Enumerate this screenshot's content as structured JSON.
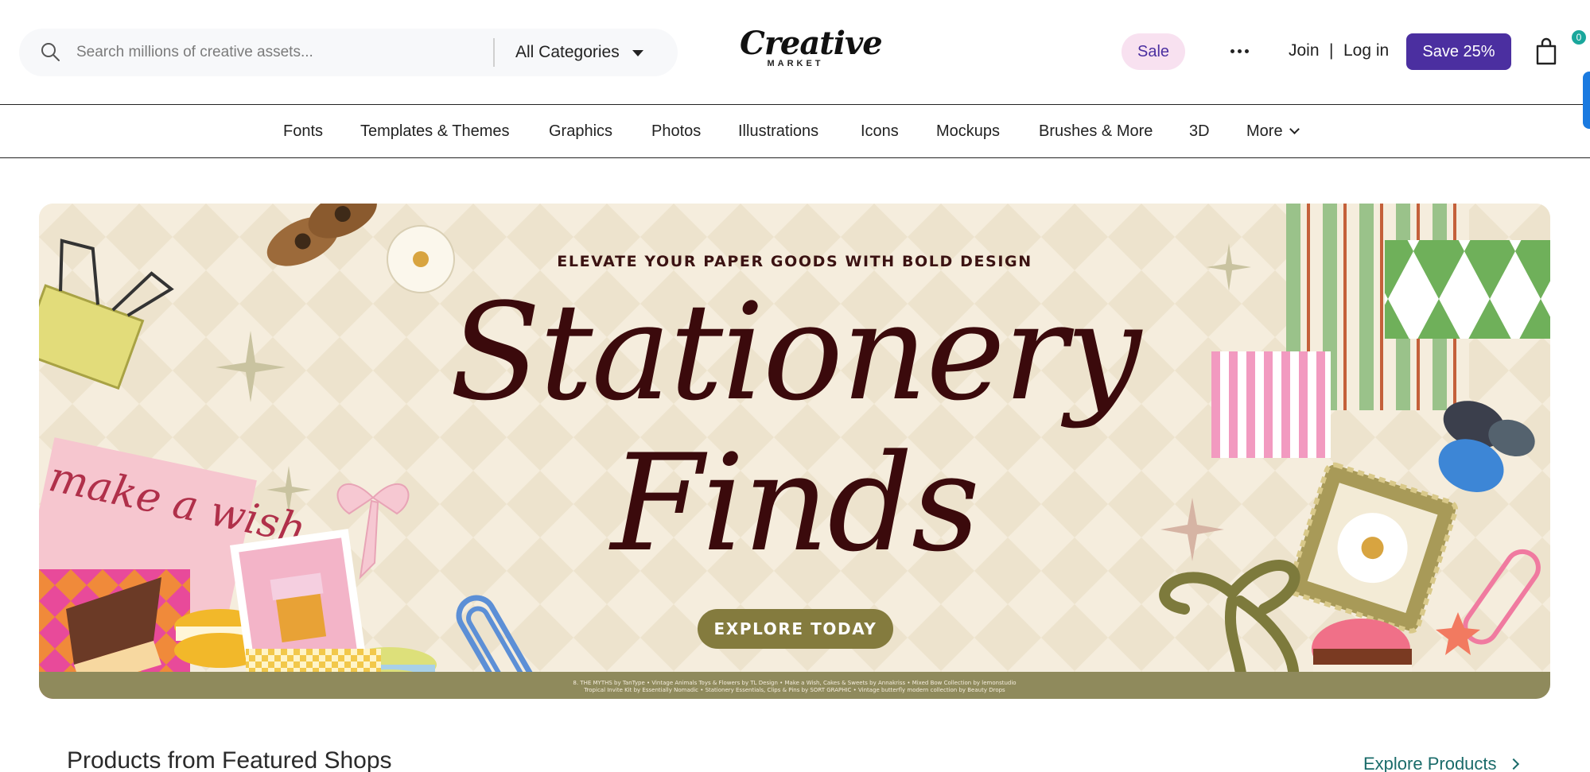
{
  "header": {
    "search": {
      "placeholder": "Search millions of creative assets...",
      "category": "All Categories",
      "icon": "search-icon"
    },
    "logo": {
      "main": "Creative",
      "sub": "MARKET"
    },
    "sale_label": "Sale",
    "more_icon": "more-dots-icon",
    "join_label": "Join",
    "separator": "|",
    "login_label": "Log in",
    "save_label": "Save 25%",
    "cart": {
      "icon": "shopping-bag-icon",
      "count": "0"
    }
  },
  "nav": {
    "items": [
      {
        "label": "Fonts"
      },
      {
        "label": "Templates & Themes"
      },
      {
        "label": "Graphics"
      },
      {
        "label": "Photos"
      },
      {
        "label": "Illustrations"
      },
      {
        "label": "Icons"
      },
      {
        "label": "Mockups"
      },
      {
        "label": "Brushes & More"
      },
      {
        "label": "3D"
      },
      {
        "label": "More"
      }
    ]
  },
  "banner": {
    "eyebrow": "ELEVATE YOUR PAPER GOODS WITH BOLD DESIGN",
    "headline_line1": "Stationery",
    "headline_line2": "Finds",
    "cta": "EXPLORE TODAY",
    "card_text": "make a wish",
    "credits_line1": "8. THE MYTHS by TanType • Vintage Animals Toys & Flowers by TL Design • Make a Wish, Cakes & Sweets by Annakriss • Mixed Bow Collection by lemonstudio",
    "credits_line2": "Tropical Invite Kit by Essentially Nomadic • Stationery Essentials, Clips & Pins by SORT GRAPHIC • Vintage butterfly modern collection by Beauty Drops",
    "colors": {
      "background": "#f4ecdc",
      "headline": "#3b0a0c",
      "cta": "#847b3e"
    }
  },
  "section": {
    "title": "Products from Featured Shops",
    "link_label": "Explore Products"
  },
  "colors": {
    "brand_purple": "#4b2fa0",
    "sale_pink": "#f8e1f0",
    "teal_link": "#1a6b6a",
    "cart_badge": "#1aa79c"
  }
}
